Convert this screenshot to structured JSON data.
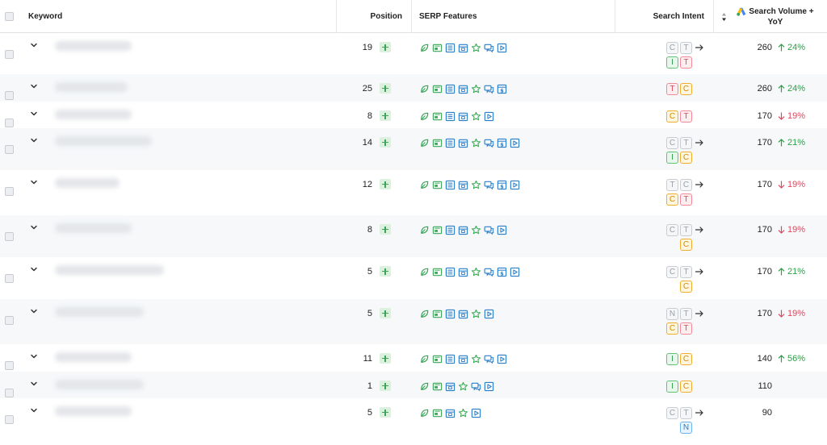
{
  "header": {
    "keyword": "Keyword",
    "position": "Position",
    "serp_features": "SERP Features",
    "search_intent": "Search Intent",
    "search_volume_line1": "Search Volume +",
    "search_volume_line2": "YoY"
  },
  "colors": {
    "up": "#2e9e46",
    "down": "#d94b5f",
    "icon_green": "#3aa557",
    "icon_blue": "#2a7dc7",
    "badge_c": "#f0ad2f",
    "badge_t": "#f08a98",
    "badge_i": "#61c27a",
    "badge_n": "#6fb3ec"
  },
  "rows": [
    {
      "position": "19",
      "serp": [
        "leaf",
        "image",
        "list",
        "calendar",
        "star",
        "chat",
        "video"
      ],
      "intent": [
        [
          "C",
          "T"
        ],
        [
          "I",
          "T"
        ]
      ],
      "intent_arrow": true,
      "volume": "260",
      "yoy": "24%",
      "trend": "up"
    },
    {
      "position": "25",
      "serp": [
        "leaf",
        "image",
        "list",
        "calendar",
        "star",
        "chat",
        "dollar"
      ],
      "intent": [
        [
          "T",
          "C"
        ]
      ],
      "intent_arrow": false,
      "volume": "260",
      "yoy": "24%",
      "trend": "up"
    },
    {
      "position": "8",
      "serp": [
        "leaf",
        "image",
        "list",
        "calendar",
        "star",
        "video"
      ],
      "intent": [
        [
          "C",
          "T"
        ]
      ],
      "intent_arrow": false,
      "volume": "170",
      "yoy": "19%",
      "trend": "down"
    },
    {
      "position": "14",
      "serp": [
        "leaf",
        "image",
        "list",
        "calendar",
        "star",
        "chat",
        "dollar",
        "video"
      ],
      "intent": [
        [
          "C",
          "T"
        ],
        [
          "I",
          "C"
        ]
      ],
      "intent_arrow": true,
      "volume": "170",
      "yoy": "21%",
      "trend": "up"
    },
    {
      "position": "12",
      "serp": [
        "leaf",
        "image",
        "list",
        "calendar",
        "star",
        "chat",
        "dollar",
        "video"
      ],
      "intent": [
        [
          "T",
          "C"
        ],
        [
          "C",
          "T"
        ]
      ],
      "intent_arrow": true,
      "volume": "170",
      "yoy": "19%",
      "trend": "down"
    },
    {
      "position": "8",
      "serp": [
        "leaf",
        "image",
        "list",
        "calendar",
        "star",
        "chat",
        "video"
      ],
      "intent": [
        [
          "C",
          "T"
        ],
        [
          "C"
        ]
      ],
      "intent_arrow": true,
      "volume": "170",
      "yoy": "19%",
      "trend": "down"
    },
    {
      "position": "5",
      "serp": [
        "leaf",
        "image",
        "list",
        "calendar",
        "star",
        "chat",
        "dollar",
        "video"
      ],
      "intent": [
        [
          "C",
          "T"
        ],
        [
          "C"
        ]
      ],
      "intent_arrow": true,
      "volume": "170",
      "yoy": "21%",
      "trend": "up"
    },
    {
      "position": "5",
      "serp": [
        "leaf",
        "image",
        "list",
        "calendar",
        "star",
        "video"
      ],
      "intent": [
        [
          "N",
          "T"
        ],
        [
          "C",
          "T"
        ]
      ],
      "intent_arrow": true,
      "volume": "170",
      "yoy": "19%",
      "trend": "down"
    },
    {
      "position": "11",
      "serp": [
        "leaf",
        "image",
        "list",
        "calendar",
        "star",
        "chat",
        "video"
      ],
      "intent": [
        [
          "I",
          "C"
        ]
      ],
      "intent_arrow": false,
      "volume": "140",
      "yoy": "56%",
      "trend": "up"
    },
    {
      "position": "1",
      "serp": [
        "leaf",
        "image",
        "calendar",
        "star",
        "chat",
        "video"
      ],
      "intent": [
        [
          "I",
          "C"
        ]
      ],
      "intent_arrow": false,
      "volume": "110",
      "yoy": "",
      "trend": ""
    },
    {
      "position": "5",
      "serp": [
        "leaf",
        "image",
        "calendar",
        "star",
        "video"
      ],
      "intent": [
        [
          "C",
          "T"
        ],
        [
          "N"
        ]
      ],
      "intent_arrow": true,
      "volume": "90",
      "yoy": "",
      "trend": ""
    }
  ]
}
